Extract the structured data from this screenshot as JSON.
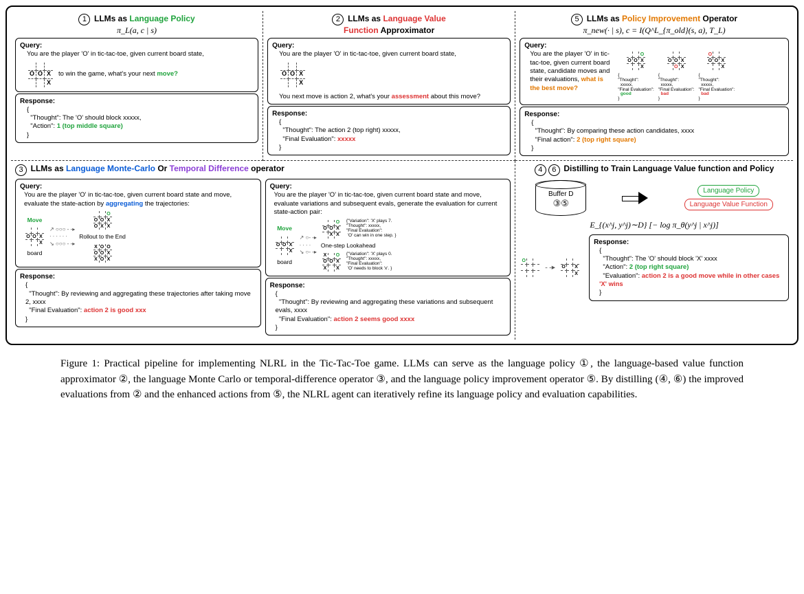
{
  "panel1": {
    "num": "1",
    "title_pre": "LLMs as ",
    "title_color": "Language Policy",
    "formula": "π_L(a, c | s)",
    "query_label": "Query:",
    "query_text1": "You are the player 'O' in tic-tac-toe, given current board state,",
    "query_text2": "to win the game, what's your next ",
    "query_move": "move?",
    "response_label": "Response:",
    "response_text": "\"Thought\": The 'O' should block xxxxx,",
    "response_action_key": "\"Action\": ",
    "response_action_val": "1 (top middle square)"
  },
  "panel2": {
    "num": "2",
    "title_pre": "LLMs as ",
    "title_color": "Language Value",
    "title_color2": "Function",
    "title_post": " Approximator",
    "query_label": "Query:",
    "query_text1": "You are the player 'O' in tic-tac-toe, given current board state,",
    "query_text2a": "You next move is action 2, what's your ",
    "query_text2b": "assessment",
    "query_text2c": " about this move?",
    "response_label": "Response:",
    "response_text": "\"Thought\": The action 2 (top right) xxxxx,",
    "response_eval_key": "\"Final Evaluation\": ",
    "response_eval_val": "xxxxx"
  },
  "panel5": {
    "num": "5",
    "title_pre": "LLMs as ",
    "title_color": "Policy Improvement",
    "title_post": " Operator",
    "formula": "π_new(· | s), c = I(Q^L_{π_old}(s, a), T_L)",
    "query_label": "Query:",
    "query_text1": "You are the player 'O' in tic-tac-toe, given current board state, candidate moves and their evaluations,",
    "query_text2": " what is the best move?",
    "eval_thought": "\"Thought\":",
    "eval_thought_val": "xxxxx,",
    "eval_final": "\"Final Evaluation\":",
    "eval_good": "good",
    "eval_bad": "bad",
    "response_label": "Response:",
    "response_text": "\"Thought\": By comparing these action candidates, xxxx",
    "response_action_key": "\"Final action\": ",
    "response_action_val": "2 (top right square)"
  },
  "panel3": {
    "num": "3",
    "title_pre": "LLMs as ",
    "title_color1": "Language Monte-Carlo",
    "title_mid": " Or ",
    "title_color2": "Temporal Difference",
    "title_post": " operator",
    "q1_label": "Query:",
    "q1_text": "You are the player 'O' in tic-tac-toe, given current board state and move, evaluate the state-action by ",
    "q1_agg": "aggregating",
    "q1_text2": " the trajectories:",
    "move_label": "Move",
    "board_label": "board",
    "rollout": "Rollout to the End",
    "q2_label": "Query:",
    "q2_text": "You are the player 'O' in tic-tac-toe, given current board state and move, evaluate variations and subsequent evals, generate the evaluation for current state-action pair:",
    "onestep": "One-step Lookahead",
    "var1_a": "\"Variation\": 'X' plays 7.",
    "var1_b": "\"Thought\": xxxxx,",
    "var1_c": "\"Final Evaluation\":",
    "var1_d": "'O' can win in one step.",
    "var2_a": "\"Variation\": 'X' plays 0.",
    "var2_d": "'O' needs to block 'x'.",
    "r1_label": "Response:",
    "r1_text": "\"Thought\": By reviewing and aggregating these trajectories after taking move 2, xxxx",
    "r1_eval_key": "\"Final Evaluation\": ",
    "r1_eval_val": "action 2 is good xxx",
    "r2_label": "Response:",
    "r2_text": "\"Thought\": By reviewing and aggregating these variations and subsequent evals, xxxx",
    "r2_eval_key": "\"Final Evaluation\": ",
    "r2_eval_val": "action 2 seems good xxxx"
  },
  "panel46": {
    "num1": "4",
    "num2": "6",
    "title": "Distilling to Train Language Value function and Policy",
    "buffer": "Buffer D",
    "buffer_nums": "③⑤",
    "policy_tag": "Language Policy",
    "value_tag": "Language Value Function",
    "loss": "E_{(x^j, y^j)∼D} [− log π_θ(y^j | x^j)]",
    "response_label": "Response:",
    "r_thought": "\"Thought\": The 'O' should block 'X' xxxx",
    "r_action_key": "\"Action\": ",
    "r_action_val": "2 (top right square)",
    "r_eval_key": "\"Evaluation\": ",
    "r_eval_val": "action 2 is a good move while in other cases 'X' wins"
  },
  "caption": {
    "text": "Figure 1: Practical pipeline for implementing NLRL in the Tic-Tac-Toe game. LLMs can serve as the language policy ①, the language-based value function approximator ②, the language Monte Carlo or temporal-difference operator ③, and the language policy improvement operator ⑤. By distilling (④, ⑥) the improved evaluations from ② and the enhanced actions from ⑤, the NLRL agent can iteratively refine its language policy and evaluation capabilities."
  }
}
